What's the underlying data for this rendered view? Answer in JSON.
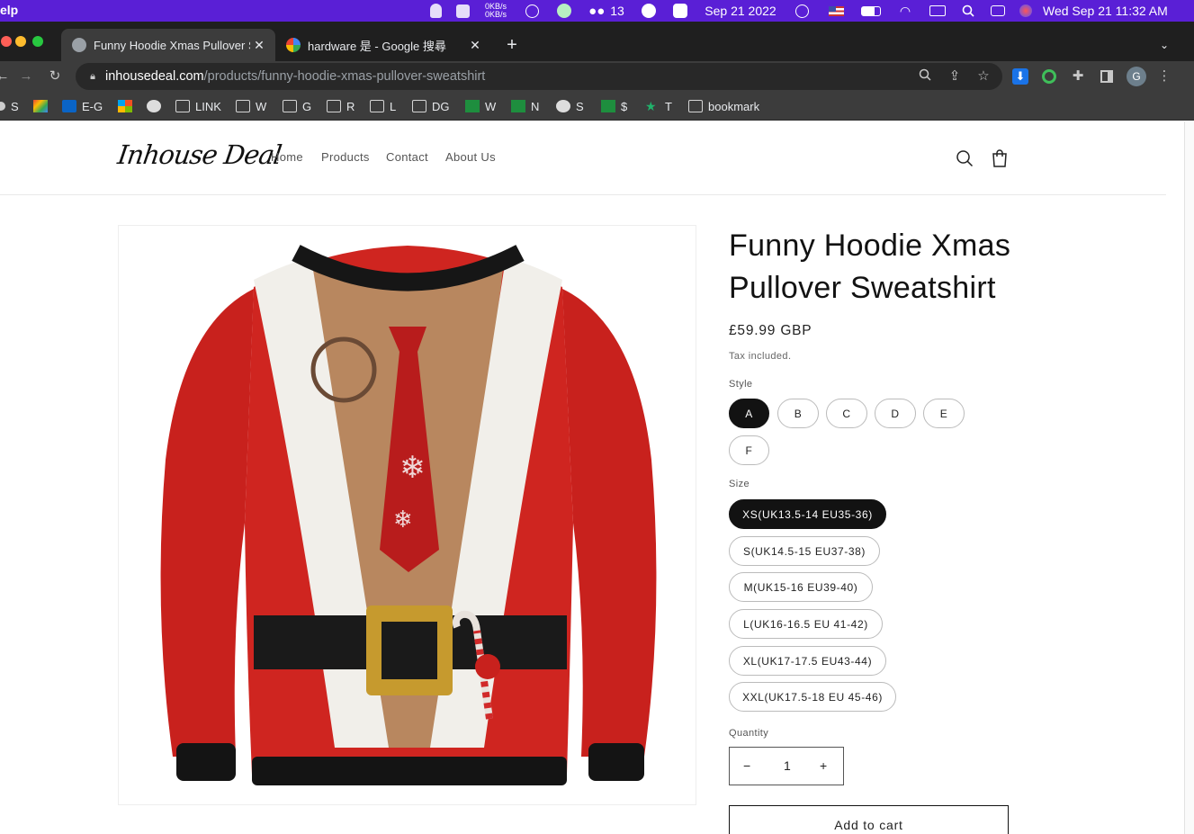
{
  "menubar": {
    "app_label": "elp",
    "net_up": "0KB/s",
    "net_down": "0KB/s",
    "wechat_count": "13",
    "date_short": "Sep 21 2022",
    "clock": "Wed Sep 21  11:32 AM"
  },
  "tabs": [
    {
      "title": "Funny Hoodie Xmas Pullover Sweatshirt",
      "active": true
    },
    {
      "title": "hardware 是 - Google 搜尋",
      "active": false
    }
  ],
  "address": {
    "host": "inhousedeal.com",
    "path": "/products/funny-hoodie-xmas-pullover-sweatshirt"
  },
  "profile_initial": "G",
  "bookmarks": [
    "S",
    "",
    "E-G",
    "",
    "",
    "LINK",
    "W",
    "G",
    "R",
    "L",
    "DG",
    "W",
    "N",
    "S",
    "$",
    "T",
    "bookmark"
  ],
  "store": {
    "logo": "Inhouse Deal",
    "nav": [
      "Home",
      "Products",
      "Contact",
      "About Us"
    ]
  },
  "product": {
    "title": "Funny Hoodie Xmas Pullover Sweatshirt",
    "price": "£59.99 GBP",
    "tax_note": "Tax included.",
    "style_label": "Style",
    "styles": [
      "A",
      "B",
      "C",
      "D",
      "E",
      "F"
    ],
    "selected_style": "A",
    "size_label": "Size",
    "sizes": [
      "XS(UK13.5-14 EU35-36)",
      "S(UK14.5-15 EU37-38)",
      "M(UK15-16 EU39-40)",
      "L(UK16-16.5 EU 41-42)",
      "XL(UK17-17.5 EU43-44)",
      "XXL(UK17.5-18 EU 45-46)"
    ],
    "selected_size": "XS(UK13.5-14 EU35-36)",
    "quantity_label": "Quantity",
    "quantity": "1",
    "minus": "−",
    "plus": "+",
    "add_to_cart": "Add to cart"
  },
  "colors": {
    "menubar": "#5a1fd6",
    "chrome_dark": "#1f1f1f",
    "chrome_toolbar": "#3c3c3c",
    "selected_pill": "#121212",
    "sweater_red": "#c8211d"
  }
}
